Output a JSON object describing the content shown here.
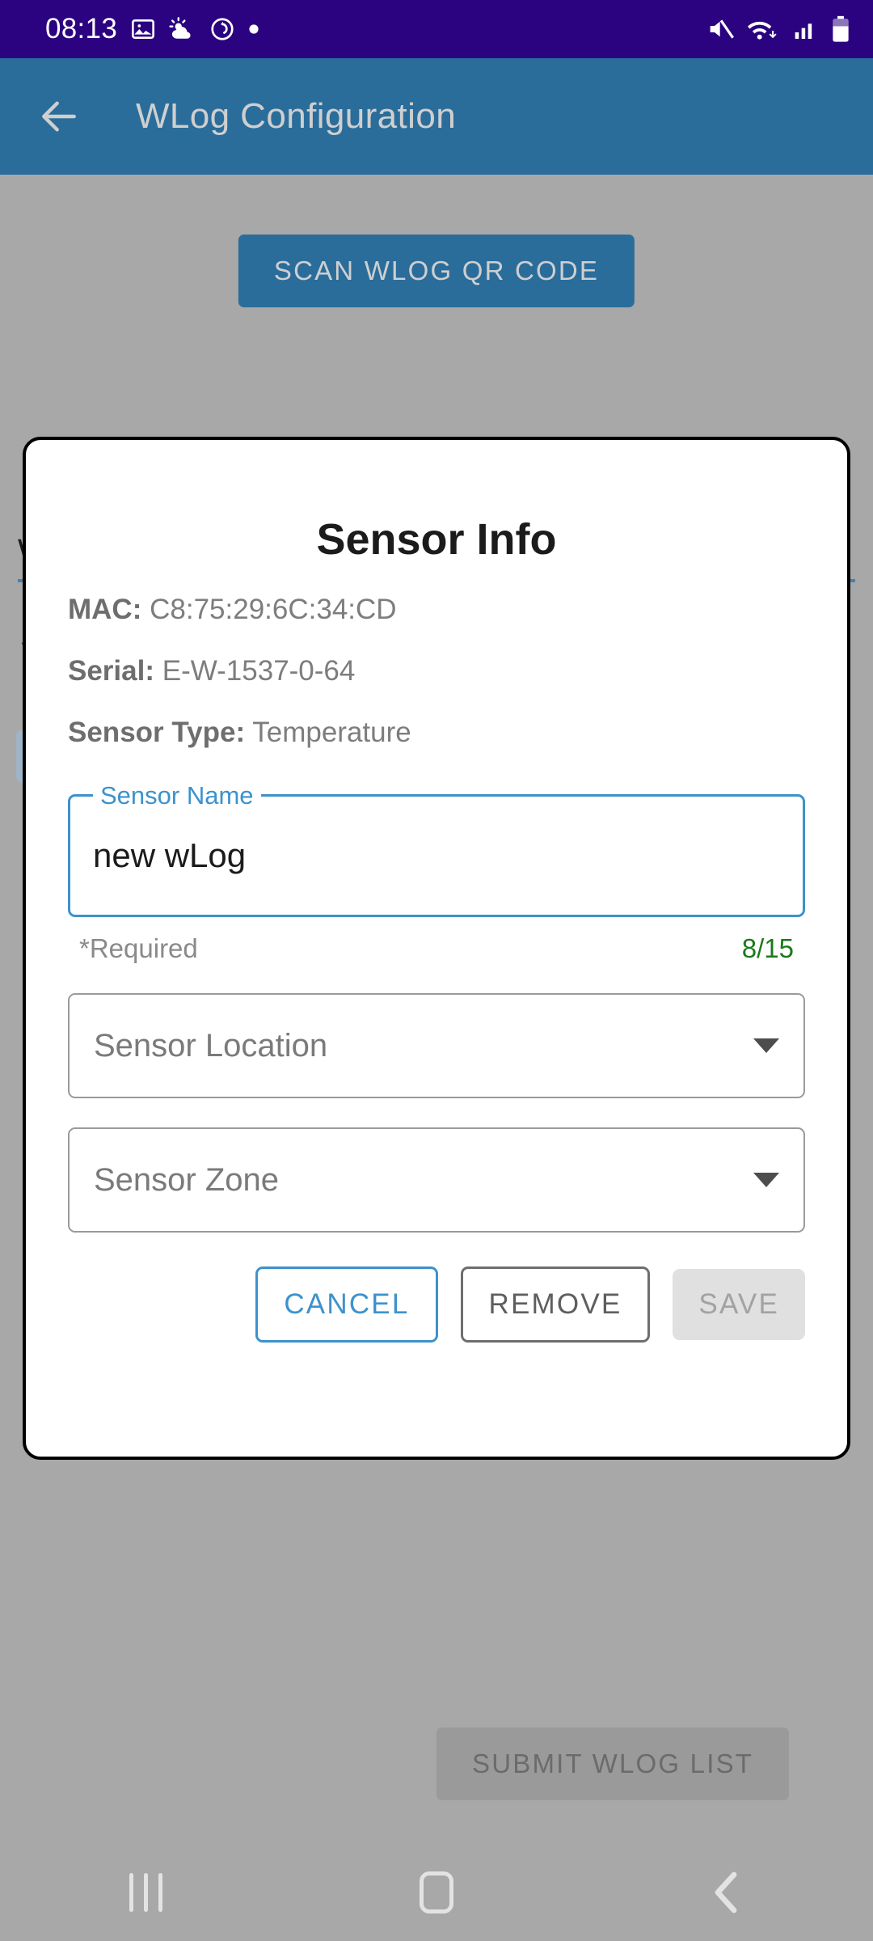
{
  "status_bar": {
    "time": "08:13",
    "left_icons": [
      "image-icon",
      "weather-icon",
      "alarm-reset-icon",
      "dot-icon"
    ],
    "right_icons": [
      "mute-icon",
      "wifi-icon",
      "signal-icon",
      "battery-icon"
    ],
    "background_color": "#2b0380"
  },
  "app_bar": {
    "title": "WLog Configuration",
    "back_icon": "back-arrow-icon",
    "background_color": "#2a6d9b",
    "title_color": "#cfcfcf"
  },
  "page": {
    "scan_button_label": "SCAN WLOG QR CODE",
    "list_section_label": "Wlog List",
    "obscured_list_item_text": "S",
    "submit_button_label": "SUBMIT WLOG LIST",
    "background_color": "#a8a8a8",
    "accent_color": "#2a6d9b"
  },
  "dialog": {
    "title": "Sensor Info",
    "info": [
      {
        "label": "MAC:",
        "value": "C8:75:29:6C:34:CD"
      },
      {
        "label": "Serial:",
        "value": "E-W-1537-0-64"
      },
      {
        "label": "Sensor Type:",
        "value": "Temperature"
      }
    ],
    "sensor_name": {
      "label": "Sensor Name",
      "value": "new wLog",
      "placeholder": "Sensor Name",
      "helper": "*Required",
      "counter": "8/15",
      "counter_color": "#1a7a1a",
      "focus_color": "#3d92cc"
    },
    "selects": [
      {
        "name": "sensor-location",
        "value": "Sensor Location",
        "arrow_icon": "chevron-down-icon"
      },
      {
        "name": "sensor-zone",
        "value": "Sensor Zone",
        "arrow_icon": "chevron-down-icon"
      }
    ],
    "actions": {
      "cancel": "CANCEL",
      "remove": "REMOVE",
      "save": "SAVE"
    }
  },
  "nav_bar": {
    "recents_icon": "recents-icon",
    "home_icon": "home-icon",
    "back_icon": "back-chevron-icon"
  }
}
